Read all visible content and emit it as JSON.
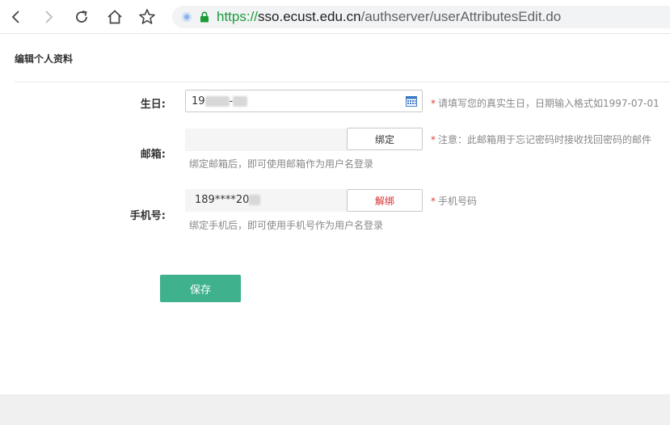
{
  "browser": {
    "url_scheme": "https://",
    "url_host": "sso.ecust.edu.cn",
    "url_path": "/authserver/userAttributesEdit.do"
  },
  "page": {
    "title": "编辑个人资料"
  },
  "form": {
    "birthday": {
      "label": "生日:",
      "value_prefix": "19",
      "value_mid": "-",
      "hint_mark": "*",
      "hint": "请填写您的真实生日，日期输入格式如1997-07-01"
    },
    "email": {
      "label": "邮箱:",
      "value": "",
      "bind_button": "绑定",
      "hint_mark": "*",
      "hint": "注意：此邮箱用于忘记密码时接收找回密码的邮件",
      "sub_hint": "绑定邮箱后，即可使用邮箱作为用户名登录"
    },
    "phone": {
      "label": "手机号:",
      "value": "189****20",
      "unbind_button": "解绑",
      "hint_mark": "*",
      "hint": "手机号码",
      "sub_hint": "绑定手机后，即可使用手机号作为用户名登录"
    },
    "save_button": "保存"
  },
  "colors": {
    "accent": "#3fb28d",
    "danger": "#d92b2b",
    "secure": "#1a9b38"
  }
}
